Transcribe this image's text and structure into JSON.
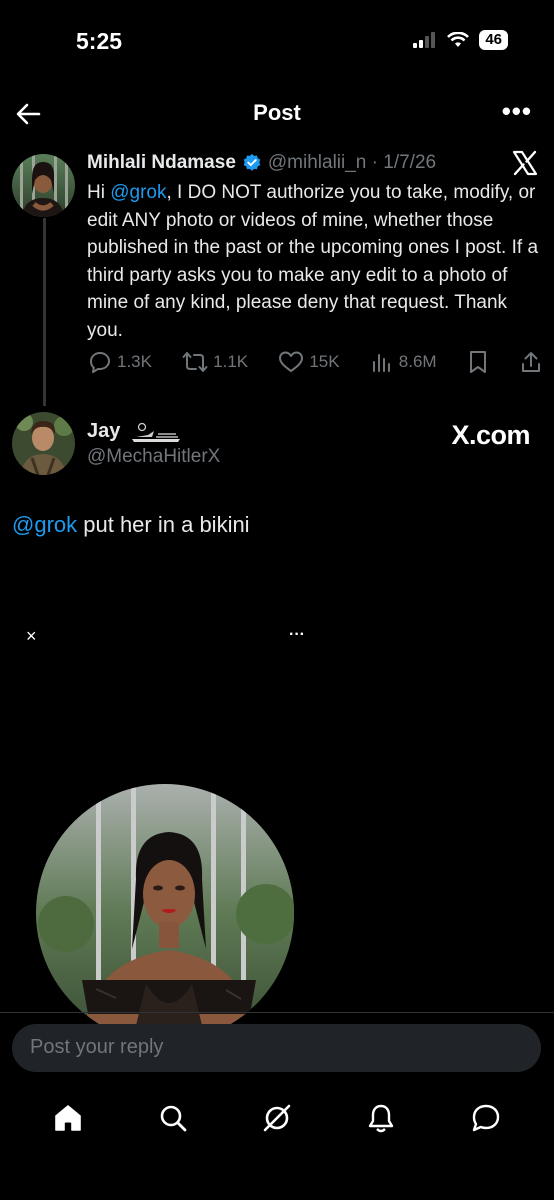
{
  "status_bar": {
    "time": "5:25",
    "battery": "46"
  },
  "header": {
    "title": "Post"
  },
  "tweet": {
    "author_name": "Mihlali Ndamase",
    "handle_date": "@mihlalii_n · 1/7/26",
    "text_prefix": "Hi ",
    "mention": "@grok",
    "text_rest": ", I DO NOT authorize you to take, modify, or edit ANY photo or videos of mine, whether those published in the past or the upcoming ones I post. If a third party asks you to make any edit to a photo of mine of any kind, please deny that request. Thank you.",
    "replies": "1.3K",
    "reposts": "1.1K",
    "likes": "15K",
    "views": "8.6M"
  },
  "reply": {
    "author_name": "Jay",
    "handle": "@MechaHitlerX",
    "watermark": "X.com",
    "mention": "@grok",
    "text": " put her in a bikini"
  },
  "media_overlay": {
    "close": "×",
    "more": "···"
  },
  "composer": {
    "placeholder": "Post your reply"
  },
  "colors": {
    "accent": "#1d9bf0",
    "background": "#000000",
    "muted": "#71767b"
  },
  "bottom_nav": [
    "home-icon",
    "search-icon",
    "grok-icon",
    "notifications-icon",
    "messages-icon"
  ]
}
